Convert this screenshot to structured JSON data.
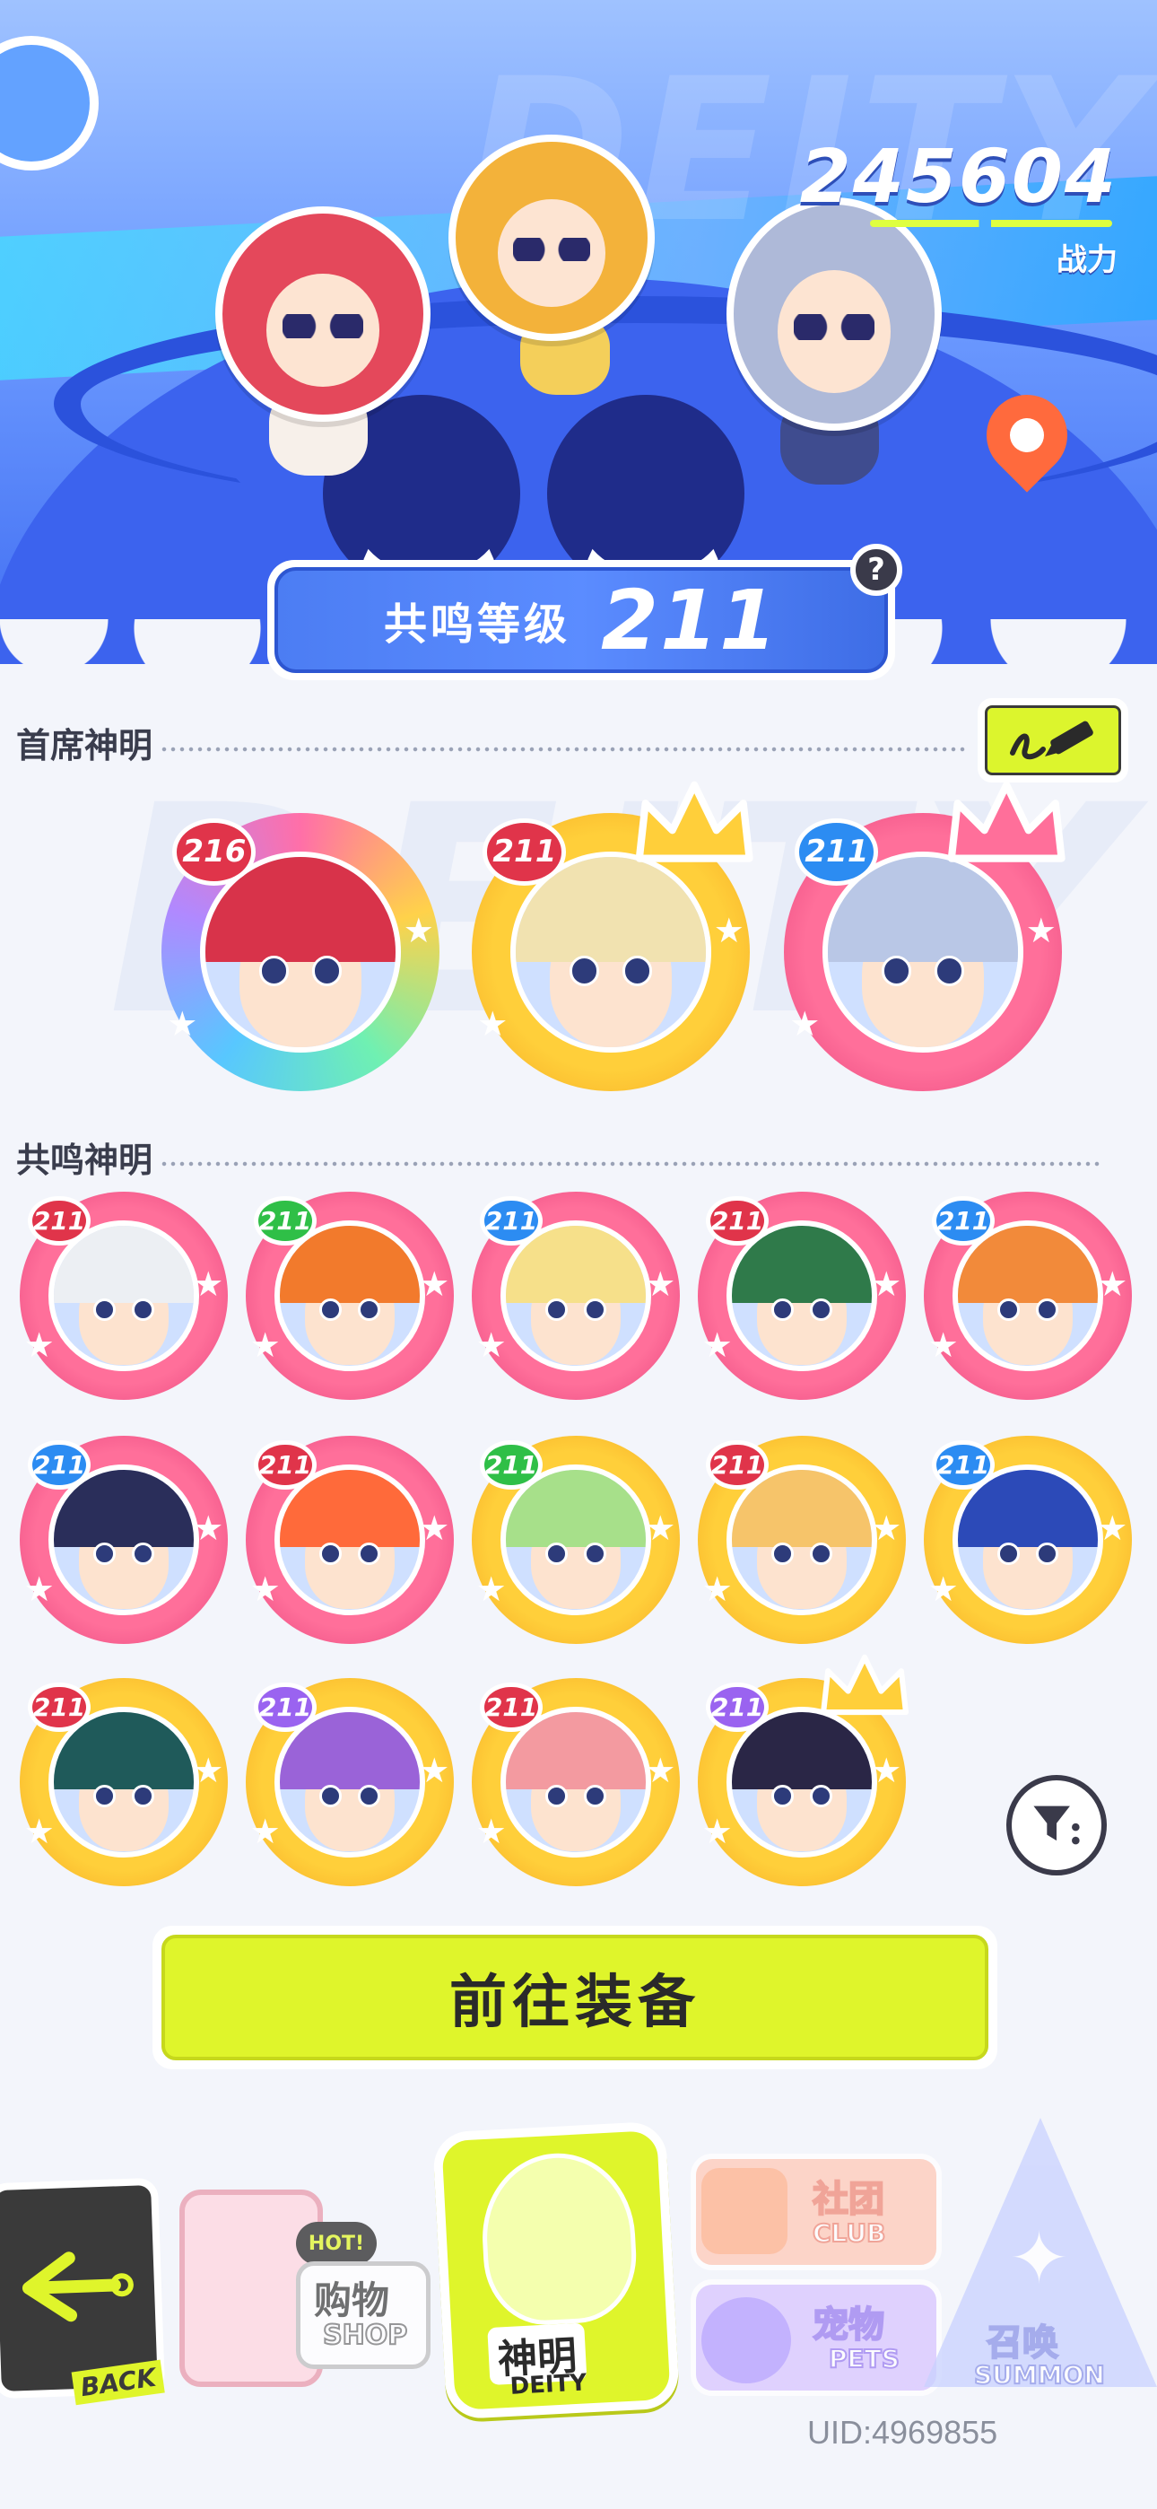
{
  "header": {
    "power_value": "245604",
    "power_label": "战力",
    "watermark": "DEITY"
  },
  "resonance": {
    "label": "共鸣等级",
    "level": "211",
    "help_icon": "?"
  },
  "sections": {
    "first_deities_title": "首席神明",
    "resonance_deities_title": "共鸣神明"
  },
  "first_deities": [
    {
      "level": "216",
      "frame": "rainbow",
      "level_color": "red",
      "hair": "#d8334a",
      "crown": false
    },
    {
      "level": "211",
      "frame": "gold",
      "level_color": "red",
      "hair": "#f1e2b0",
      "crown": true
    },
    {
      "level": "211",
      "frame": "pink",
      "level_color": "blue",
      "hair": "#b9c7e6",
      "crown": true
    }
  ],
  "resonance_deities": [
    {
      "level": "211",
      "frame": "pink",
      "level_color": "red",
      "hair": "#eceff3"
    },
    {
      "level": "211",
      "frame": "pink",
      "level_color": "green",
      "hair": "#f27a2c"
    },
    {
      "level": "211",
      "frame": "pink",
      "level_color": "blue",
      "hair": "#f6e08a"
    },
    {
      "level": "211",
      "frame": "pink",
      "level_color": "red",
      "hair": "#2f7a4a"
    },
    {
      "level": "211",
      "frame": "pink",
      "level_color": "blue",
      "hair": "#f28a3a"
    },
    {
      "level": "211",
      "frame": "pink",
      "level_color": "blue",
      "hair": "#2a2e5a"
    },
    {
      "level": "211",
      "frame": "pink",
      "level_color": "red",
      "hair": "#ff6a3a"
    },
    {
      "level": "211",
      "frame": "gold",
      "level_color": "green",
      "hair": "#a7e08a"
    },
    {
      "level": "211",
      "frame": "gold",
      "level_color": "red",
      "hair": "#f6c46a"
    },
    {
      "level": "211",
      "frame": "gold",
      "level_color": "blue",
      "hair": "#2c4ab8"
    },
    {
      "level": "211",
      "frame": "gold",
      "level_color": "red",
      "hair": "#1f5a5a"
    },
    {
      "level": "211",
      "frame": "gold",
      "level_color": "purple",
      "hair": "#9a63d8"
    },
    {
      "level": "211",
      "frame": "gold",
      "level_color": "red",
      "hair": "#f39aa0"
    },
    {
      "level": "211",
      "frame": "gold",
      "level_color": "purple",
      "hair": "#2a2646",
      "crown": true
    }
  ],
  "buttons": {
    "equip_label": "前往装备"
  },
  "nav": {
    "back_label": "BACK",
    "shop_hot": "HOT!",
    "shop_cn": "购物",
    "shop_en": "SHOP",
    "deity_cn": "神明",
    "deity_en": "DEITY",
    "club_cn": "社团",
    "club_en": "CLUB",
    "pets_cn": "宠物",
    "pets_en": "PETS",
    "summon_cn": "召唤",
    "summon_en": "SUMMON"
  },
  "footer": {
    "uid": "UID:4969855"
  },
  "colors": {
    "accent_lime": "#dff52b",
    "hero_blue": "#3c63ee",
    "frame_gold": "#ffcf3a",
    "frame_pink": "#ff6f9a"
  }
}
